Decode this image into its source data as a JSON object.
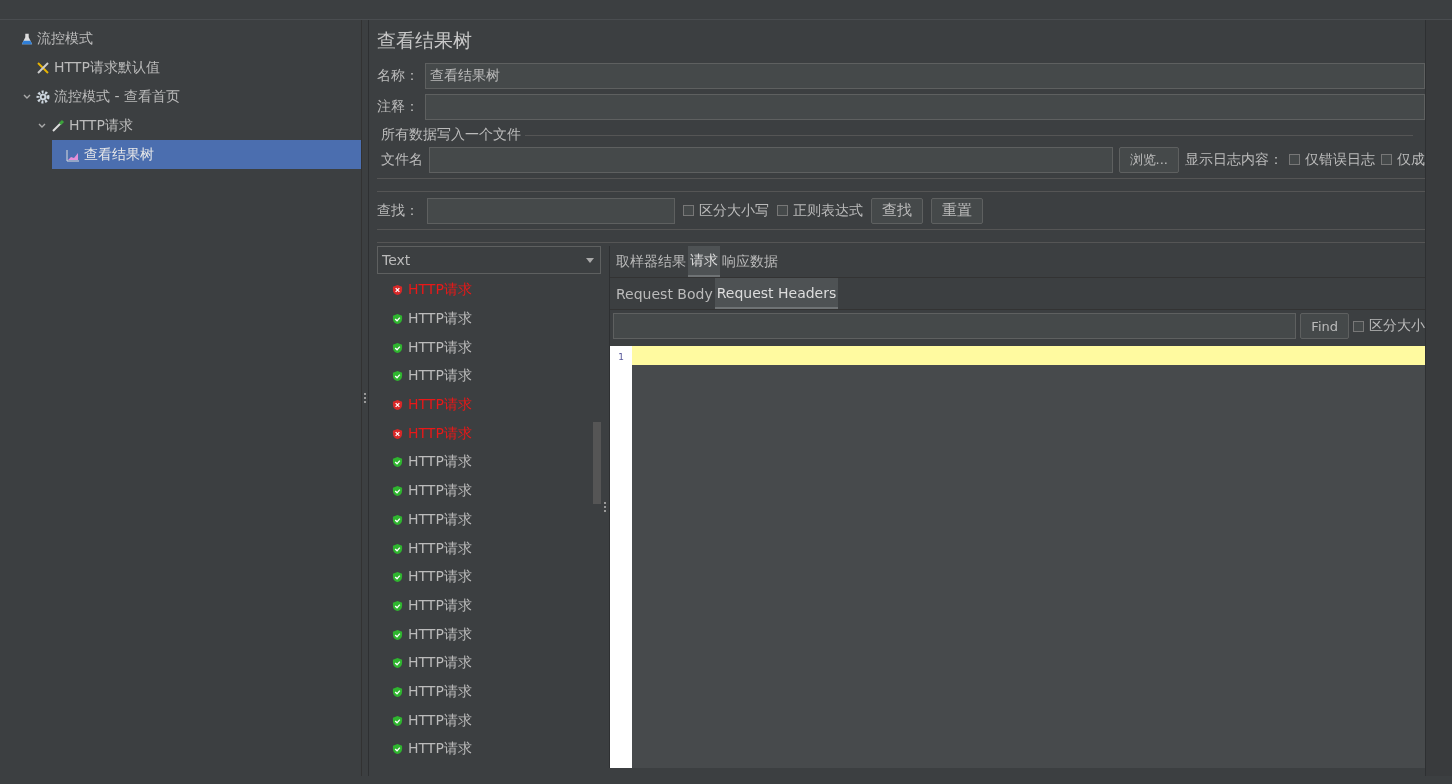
{
  "tree": [
    {
      "label": "流控模式",
      "selected": false,
      "children": [
        {
          "label": "HTTP请求默认值",
          "selected": false
        },
        {
          "label": "流控模式 - 查看首页",
          "selected": false,
          "expanded": true,
          "children": [
            {
              "label": "HTTP请求",
              "selected": false,
              "expanded": true,
              "children": [
                {
                  "label": "查看结果树",
                  "selected": true
                }
              ]
            }
          ]
        }
      ]
    }
  ],
  "panel": {
    "title": "查看结果树",
    "name": {
      "label": "名称：",
      "value": "查看结果树"
    },
    "comment": {
      "label": "注释："
    },
    "file_group": {
      "legend": "所有数据写入一个文件",
      "filename_label": "文件名",
      "browse_button": "浏览...",
      "log_label": "显示日志内容：",
      "options": [
        {
          "label": "仅错误日志",
          "checked": false
        },
        {
          "label": "仅成",
          "checked": false
        }
      ]
    },
    "search": {
      "label": "查找：",
      "options": [
        {
          "label": "区分大小写",
          "checked": false
        },
        {
          "label": "正则表达式",
          "checked": false
        }
      ],
      "buttons": [
        "查找",
        "重置"
      ]
    },
    "renderer": "Text",
    "results": [
      {
        "label": "HTTP请求",
        "failed": true
      },
      {
        "label": "HTTP请求",
        "failed": false
      },
      {
        "label": "HTTP请求",
        "failed": false
      },
      {
        "label": "HTTP请求",
        "failed": false
      },
      {
        "label": "HTTP请求",
        "failed": true
      },
      {
        "label": "HTTP请求",
        "failed": true
      },
      {
        "label": "HTTP请求",
        "failed": false
      },
      {
        "label": "HTTP请求",
        "failed": false
      },
      {
        "label": "HTTP请求",
        "failed": false
      },
      {
        "label": "HTTP请求",
        "failed": false
      },
      {
        "label": "HTTP请求",
        "failed": false
      },
      {
        "label": "HTTP请求",
        "failed": false
      },
      {
        "label": "HTTP请求",
        "failed": false
      },
      {
        "label": "HTTP请求",
        "failed": false
      },
      {
        "label": "HTTP请求",
        "failed": false
      },
      {
        "label": "HTTP请求",
        "failed": false
      },
      {
        "label": "HTTP请求",
        "failed": false
      }
    ],
    "tabs": [
      {
        "label": "取样器结果",
        "selected": false
      },
      {
        "label": "请求",
        "selected": true
      },
      {
        "label": "响应数据",
        "selected": false
      }
    ],
    "subtabs": [
      {
        "label": "Request Body",
        "selected": false
      },
      {
        "label": "Request Headers",
        "selected": true
      }
    ],
    "find": {
      "button": "Find",
      "option": {
        "label": "区分大小",
        "checked": false
      }
    },
    "editor": {
      "line_numbers": [
        "1"
      ]
    }
  }
}
